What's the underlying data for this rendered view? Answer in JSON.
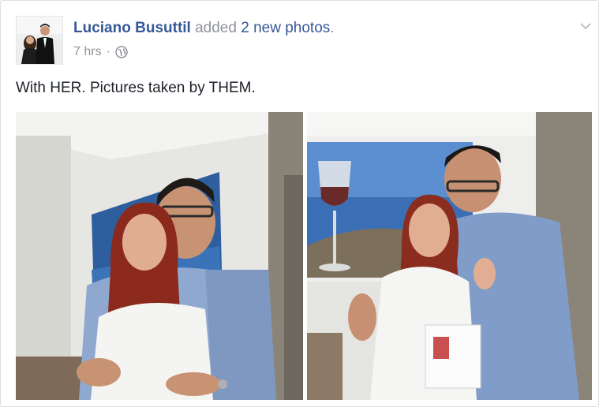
{
  "post": {
    "author": "Luciano Busuttil",
    "action_prefix": "added",
    "action_link": "2 new photos",
    "action_suffix": ".",
    "time": "7 hrs",
    "separator": "·",
    "privacy_icon": "globe-icon",
    "menu_icon": "chevron-down-icon",
    "text": "With HER. Pictures taken by THEM.",
    "photos_count": 2
  },
  "colors": {
    "link": "#365899",
    "meta": "#90949c",
    "text": "#1d2129",
    "border": "#dddfe2"
  }
}
